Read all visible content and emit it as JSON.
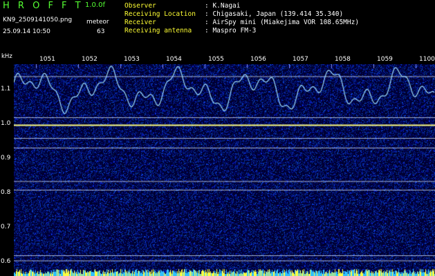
{
  "header": {
    "title": "H R O F F T",
    "version": "1.0.0f",
    "filename": "KN9_2509141050.png",
    "timestamp": "25.09.14 10:50",
    "meteor_label": "meteor",
    "meteor_count": "63"
  },
  "info": [
    {
      "label": "Observer",
      "value": ": K.Nagai"
    },
    {
      "label": "Receiving Location",
      "value": ": Chigasaki, Japan (139.414 35.340)"
    },
    {
      "label": "Receiver",
      "value": ": AirSpy mini (Miakejima VOR 108.65MHz)"
    },
    {
      "label": "Receiving antenna",
      "value": ": Maspro FM-3"
    }
  ],
  "chart_data": {
    "type": "heatmap",
    "ylabel": "kHz",
    "y_ticks": [
      "1.1",
      "1.0",
      "0.9",
      "0.8",
      "0.7",
      "0.6"
    ],
    "x_ticks": [
      "1051",
      "1052",
      "1053",
      "1054",
      "1055",
      "1056",
      "1057",
      "1058",
      "1059",
      "1100"
    ],
    "ylim": [
      0.58,
      1.18
    ],
    "colors": {
      "background": "#00004a",
      "noise": "#2a40c0",
      "trace": "#a0e0ff",
      "carrier": "#ffff80",
      "line": "#e0f0ff"
    },
    "horizontal_lines_khz": [
      1.139,
      1.02,
      0.998,
      0.96,
      0.932,
      0.835,
      0.81,
      0.62,
      0.605
    ]
  }
}
